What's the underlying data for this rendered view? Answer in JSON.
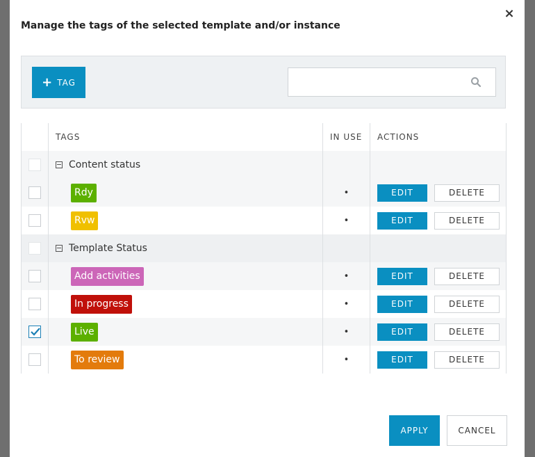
{
  "dialog": {
    "title": "Manage the tags of the selected template and/or instance",
    "close_glyph": "×"
  },
  "toolbar": {
    "add_tag_label": "TAG",
    "add_icon": "plus-icon",
    "search_placeholder": "",
    "search_icon": "search-icon"
  },
  "table": {
    "headers": [
      "",
      "TAGS",
      "IN USE",
      "ACTIONS"
    ],
    "edit_label": "EDIT",
    "delete_label": "DELETE",
    "in_use_glyph": "•",
    "rows": [
      {
        "type": "group",
        "label": "Content status"
      },
      {
        "type": "tag",
        "label": "Rdy",
        "color": "#5cb000",
        "checked": false
      },
      {
        "type": "tag",
        "label": "Rvw",
        "color": "#f0c000",
        "checked": false
      },
      {
        "type": "group",
        "label": "Template Status"
      },
      {
        "type": "tag",
        "label": "Add activities",
        "color": "#cc66b8",
        "checked": false
      },
      {
        "type": "tag",
        "label": "In progress",
        "color": "#c0100a",
        "checked": false
      },
      {
        "type": "tag",
        "label": "Live",
        "color": "#5cb000",
        "checked": true
      },
      {
        "type": "tag",
        "label": "To review",
        "color": "#e37b0c",
        "checked": false
      }
    ]
  },
  "footer": {
    "apply_label": "APPLY",
    "cancel_label": "CANCEL"
  },
  "colors": {
    "primary": "#0a8fc1",
    "overlay": "#6f6f6f"
  }
}
